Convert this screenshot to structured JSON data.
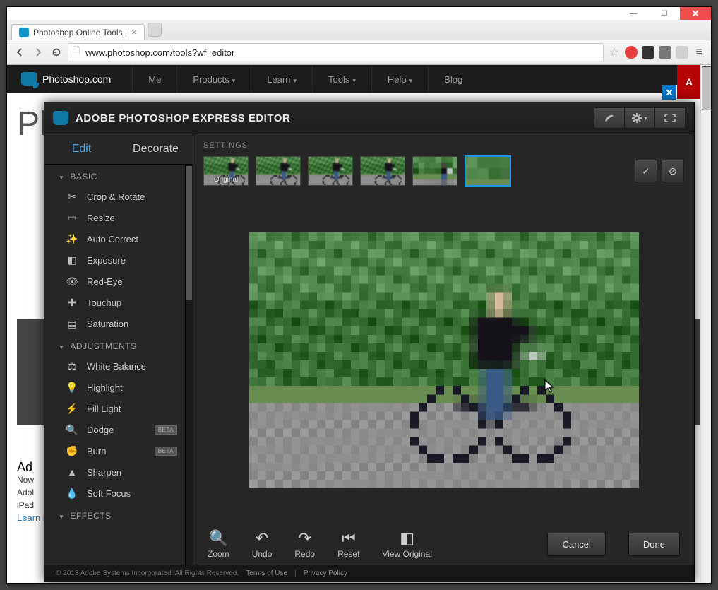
{
  "chrome": {
    "tab_title": "Photoshop Online Tools |",
    "url": "www.photoshop.com/tools?wf=editor"
  },
  "site_header": {
    "brand": "Photoshop.com",
    "nav": [
      "Me",
      "Products",
      "Learn",
      "Tools",
      "Help",
      "Blog"
    ],
    "adobe_tag": "A"
  },
  "background": {
    "big": "Ph",
    "heading": "Ad",
    "para1": "Now",
    "para2": "Adol",
    "para3": "iPad",
    "link": "Learn more about Adobe Revel"
  },
  "modal": {
    "title": "ADOBE PHOTOSHOP EXPRESS EDITOR",
    "side_tabs": {
      "edit": "Edit",
      "decorate": "Decorate"
    },
    "sections": {
      "basic": {
        "title": "BASIC",
        "items": [
          "Crop & Rotate",
          "Resize",
          "Auto Correct",
          "Exposure",
          "Red-Eye",
          "Touchup",
          "Saturation"
        ]
      },
      "adjustments": {
        "title": "ADJUSTMENTS",
        "items": [
          "White Balance",
          "Highlight",
          "Fill Light",
          "Dodge",
          "Burn",
          "Sharpen",
          "Soft Focus"
        ],
        "beta": [
          "Dodge",
          "Burn"
        ]
      },
      "effects": {
        "title": "EFFECTS"
      }
    },
    "settings_label": "SETTINGS",
    "thumbs": [
      {
        "label": "Original"
      },
      {
        "label": ""
      },
      {
        "label": ""
      },
      {
        "label": ""
      },
      {
        "label": ""
      },
      {
        "label": ""
      }
    ],
    "bottom": {
      "zoom": "Zoom",
      "undo": "Undo",
      "redo": "Redo",
      "reset": "Reset",
      "view_original": "View Original",
      "cancel": "Cancel",
      "done": "Done"
    },
    "footer": {
      "copy": "© 2013 Adobe Systems Incorporated. All Rights Reserved.",
      "terms": "Terms of Use",
      "privacy": "Privacy Policy"
    },
    "beta_badge": "BETA"
  }
}
